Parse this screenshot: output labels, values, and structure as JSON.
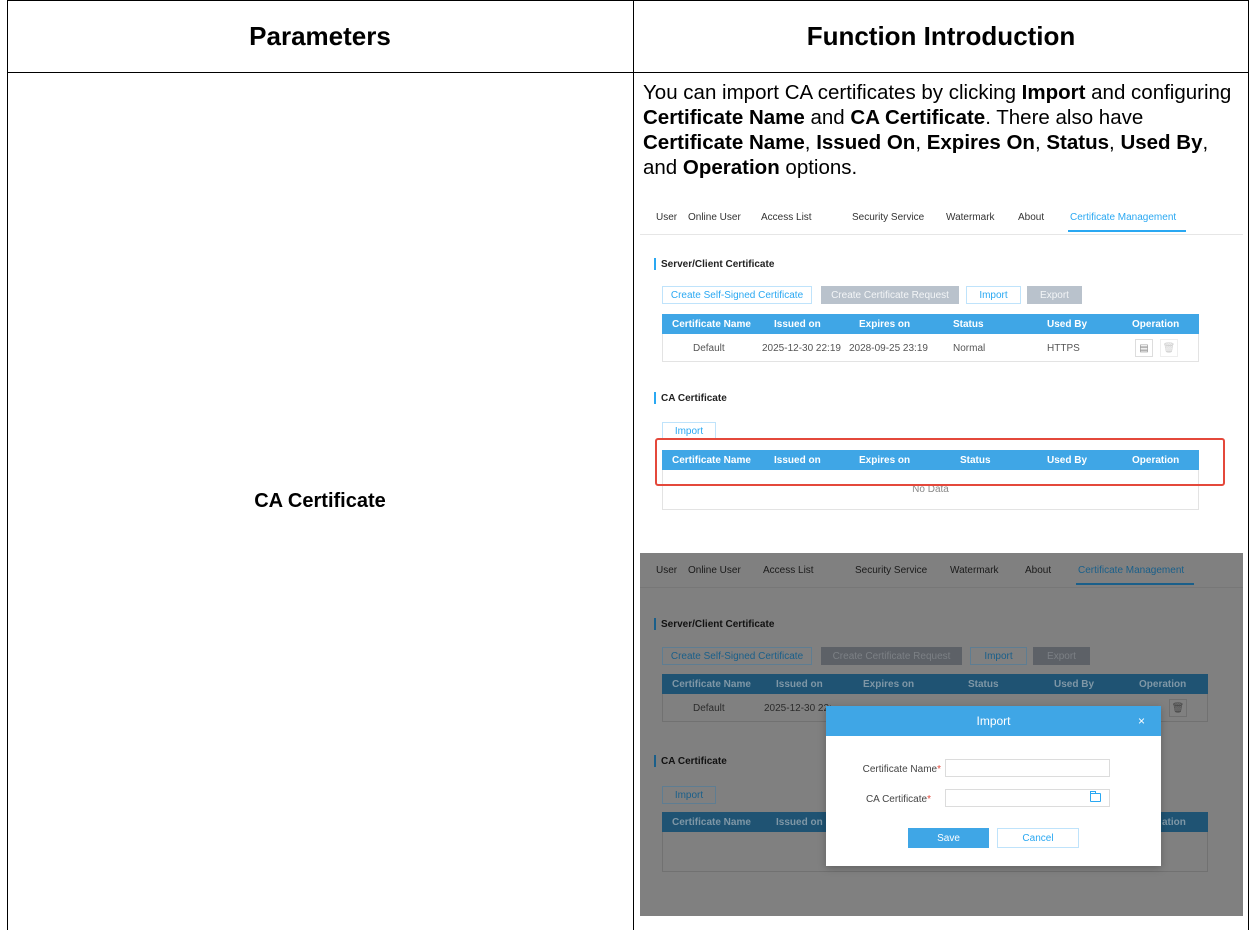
{
  "table": {
    "header_parameters": "Parameters",
    "header_function": "Function Introduction",
    "param_name": "CA Certificate"
  },
  "intro": {
    "t1": "You can import CA certificates by clicking ",
    "b1": "Import",
    "t2": " and configuring ",
    "b2": "Certificate Name",
    "t3": " and ",
    "b3": "CA Certificate",
    "t4": ". There also have ",
    "b4": "Certificate Name",
    "t5": ", ",
    "b5": "Issued On",
    "t6": ", ",
    "b6": "Expires On",
    "t7": ", ",
    "b7": "Status",
    "t8": ", ",
    "b8": "Used By",
    "t9": ", and ",
    "b9": "Operation",
    "t10": " options."
  },
  "ui": {
    "tabs": [
      "User",
      "Online User",
      "Access List",
      "Security Service",
      "Watermark",
      "About",
      "Certificate Management"
    ],
    "active_tab": "Certificate Management",
    "server_section": "Server/Client Certificate",
    "ca_section": "CA Certificate",
    "buttons": {
      "create_self_signed": "Create Self-Signed Certificate",
      "create_request": "Create Certificate Request",
      "import": "Import",
      "export": "Export"
    },
    "columns": [
      "Certificate Name",
      "Issued on",
      "Expires on",
      "Status",
      "Used By",
      "Operation"
    ],
    "server_row": {
      "name": "Default",
      "issued": "2025-12-30 22:19",
      "expires": "2028-09-25 23:19",
      "status": "Normal",
      "used_by": "HTTPS"
    },
    "server_row_issued_truncated": "2025-12-30 22:",
    "ca_no_data": "No Data",
    "truncated_operation": "ation",
    "modal": {
      "title": "Import",
      "close": "×",
      "cert_name_label": "Certificate Name",
      "ca_cert_label": "CA Certificate",
      "required_mark": "*",
      "save": "Save",
      "cancel": "Cancel"
    },
    "colors": {
      "accent": "#3fa6e6",
      "highlight": "#e4483b"
    }
  }
}
